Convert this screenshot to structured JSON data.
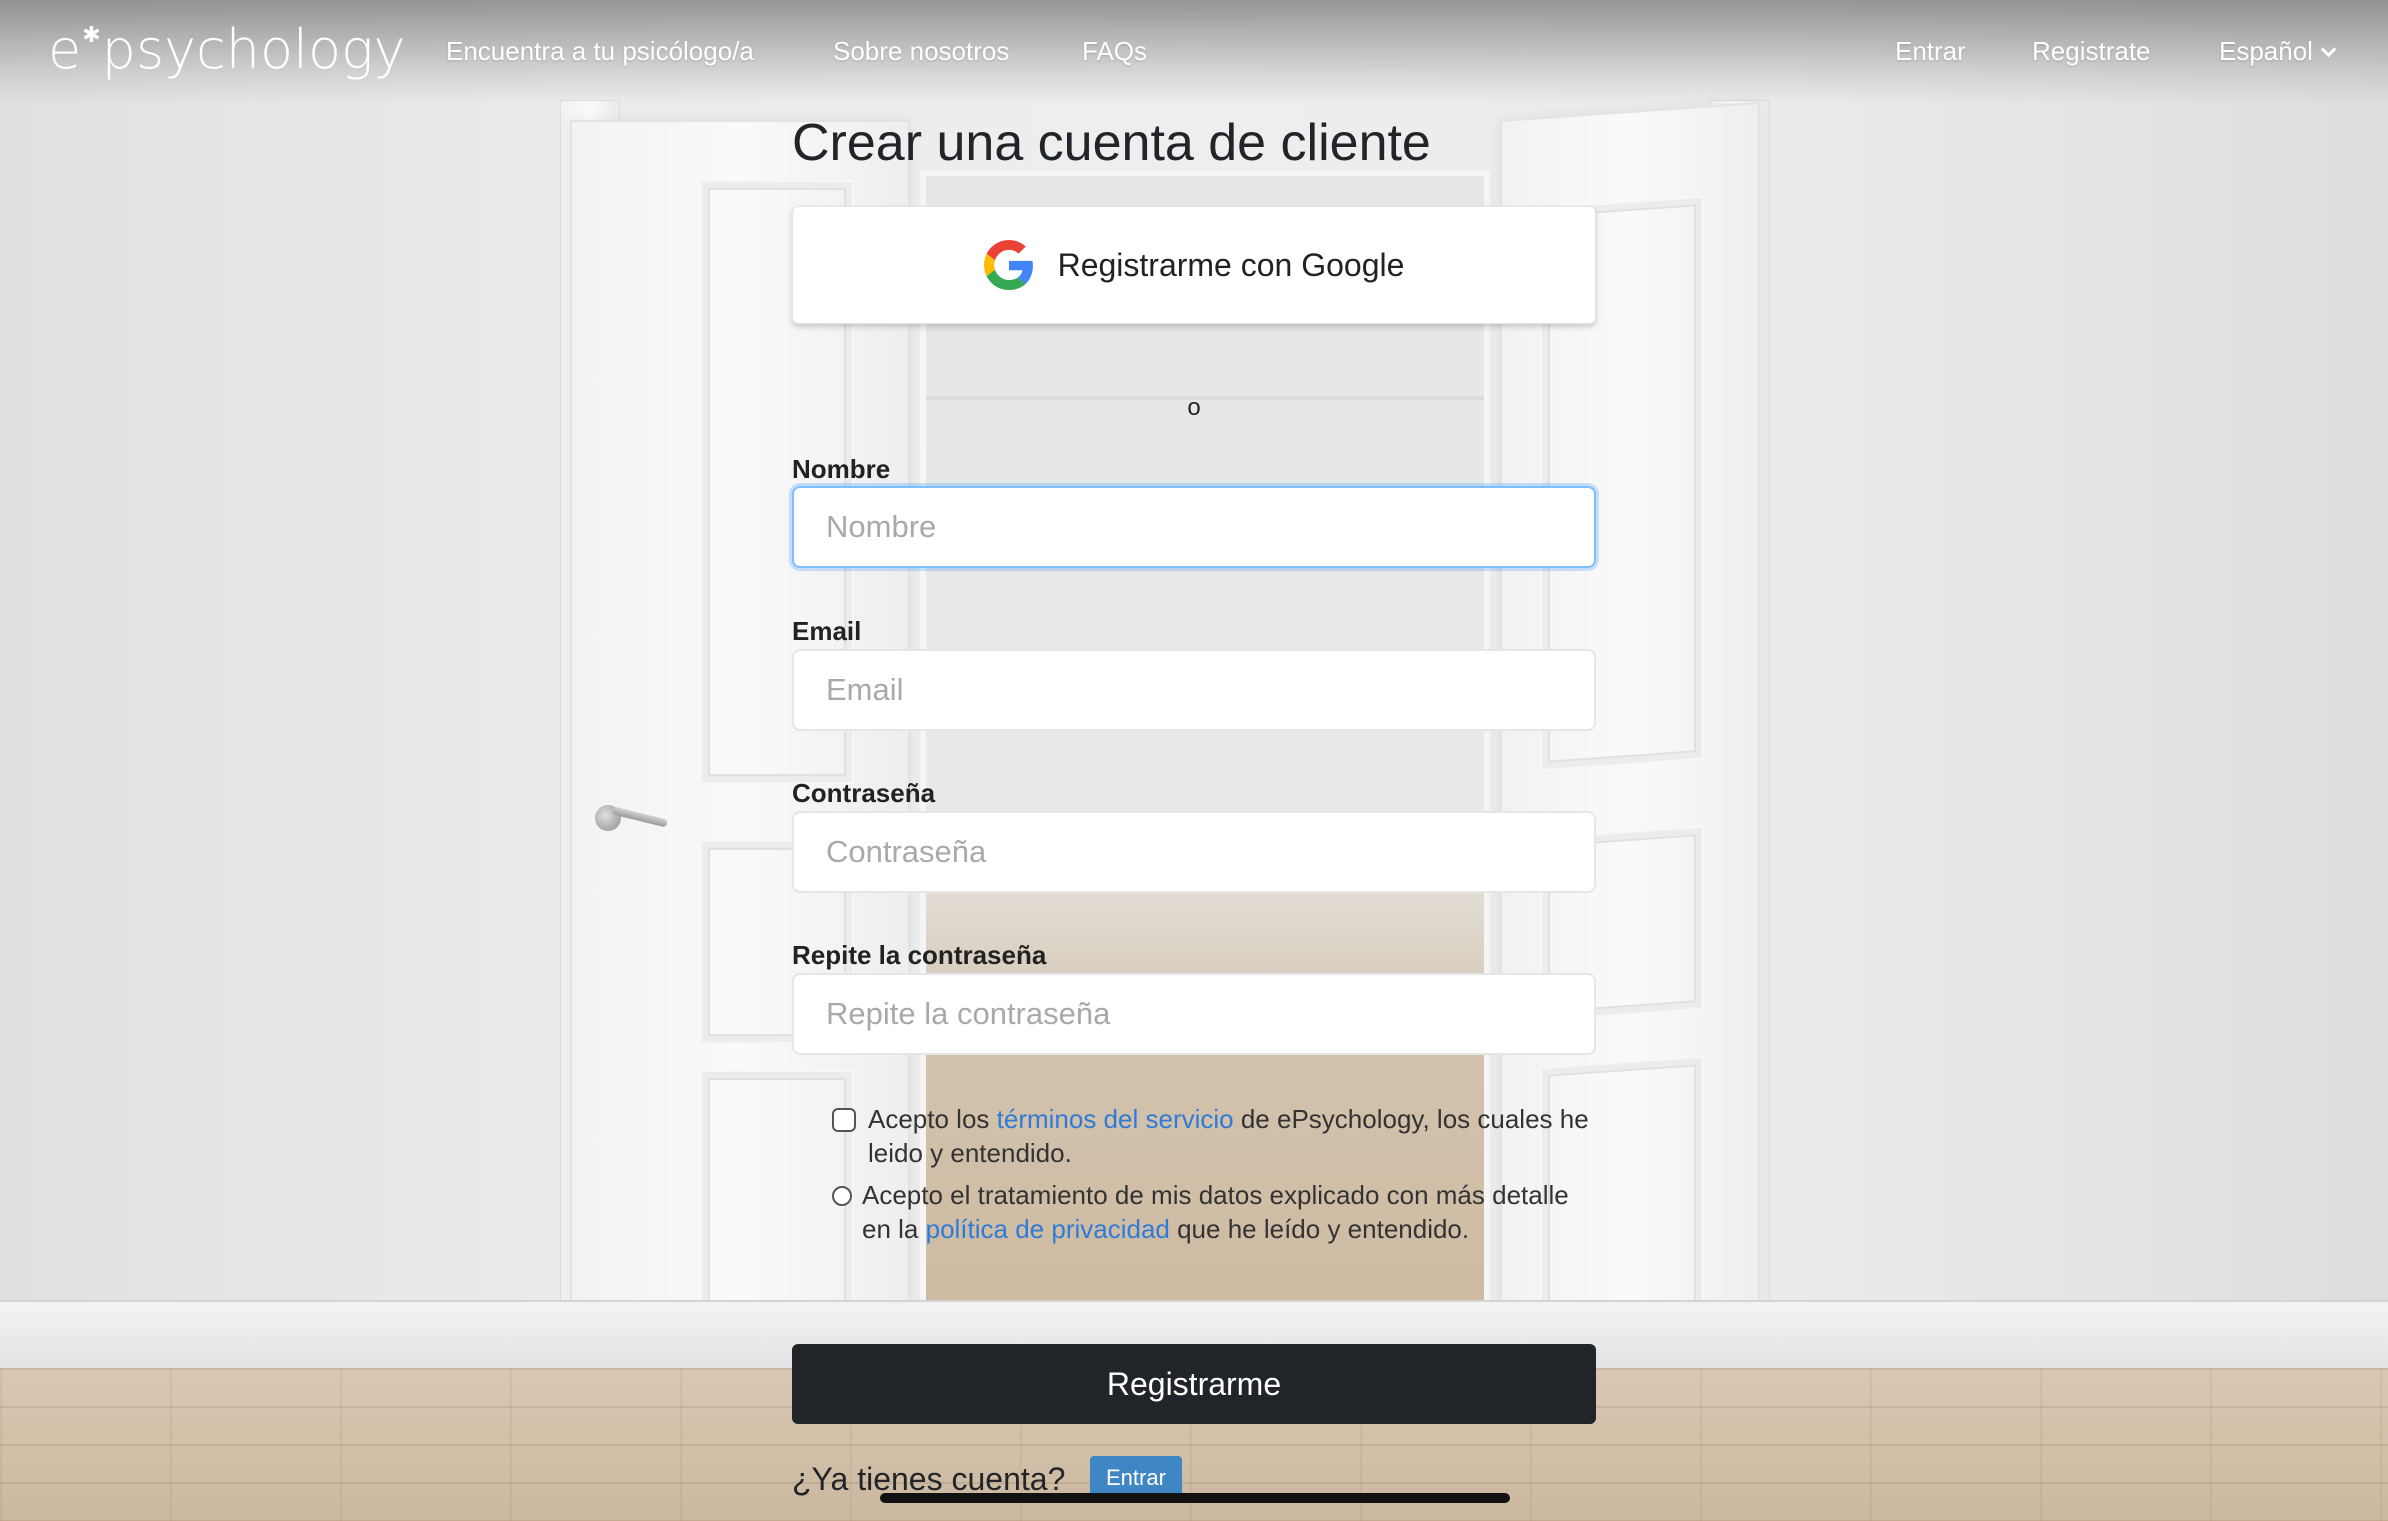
{
  "brand": {
    "name_before": "e",
    "name_after": "psychology",
    "mark": "✱"
  },
  "nav": {
    "find": "Encuentra a tu psicólogo/a",
    "about": "Sobre nosotros",
    "faqs": "FAQs",
    "login": "Entrar",
    "register": "Registrate",
    "language": "Español"
  },
  "form": {
    "title": "Crear una cuenta de cliente",
    "google_label": "Registrarme con Google",
    "separator": "o",
    "name_label": "Nombre",
    "name_placeholder": "Nombre",
    "email_label": "Email",
    "email_placeholder": "Email",
    "password_label": "Contraseña",
    "password_placeholder": "Contraseña",
    "repeat_label": "Repite la contraseña",
    "repeat_placeholder": "Repite la contraseña",
    "terms_before": "Acepto los ",
    "terms_link": "términos del servicio",
    "terms_after": " de ePsychology, los cuales he leido y entendido.",
    "privacy_before": "Acepto el tratamiento de mis datos explicado con más detalle en la ",
    "privacy_link": "política de privacidad",
    "privacy_after": " que he leído y entendido.",
    "submit": "Registrarme",
    "already": "¿Ya tienes cuenta?",
    "login_button": "Entrar"
  },
  "colors": {
    "link": "#2f7bd6",
    "dark_button": "#212529",
    "login_mini": "#3f87c4",
    "focus_border": "#80bdff"
  }
}
